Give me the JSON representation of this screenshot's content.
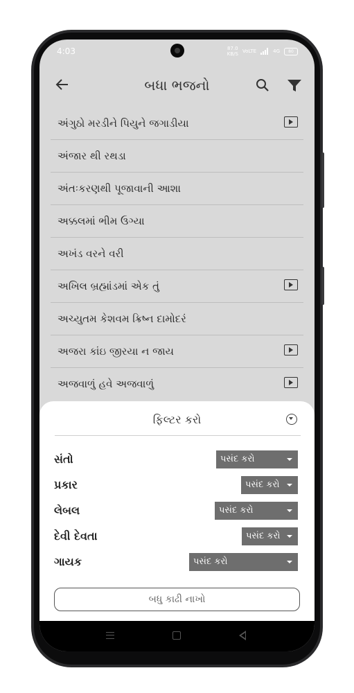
{
  "status_bar": {
    "time": "4:03",
    "net_speed_value": "87.0",
    "net_speed_unit": "KB/S",
    "volte": "VoLTE",
    "signal_2": "4G",
    "battery": "80"
  },
  "app_bar": {
    "title": "બધા ભજનો",
    "back_icon": "arrow-left",
    "search_icon": "magnifier",
    "filter_icon": "funnel"
  },
  "bhajans": [
    {
      "title": "અંગુઠો મરડીને પિયુને જગાડીયા",
      "has_video": true
    },
    {
      "title": "અંજાર થી રથડા",
      "has_video": false
    },
    {
      "title": "અંતઃકરણથી પૂજાવાની આશા",
      "has_video": false
    },
    {
      "title": "અક્કલમાં ભીમ ઉગ્યા",
      "has_video": false
    },
    {
      "title": "અખંડ વરને વરી",
      "has_video": false
    },
    {
      "title": "અખિલ બ્રહ્માંડમાં એક તું",
      "has_video": true
    },
    {
      "title": "અચ્યુતમ  કેશવમ  ક્રિષ્ન  દામોદરં",
      "has_video": false
    },
    {
      "title": "અજરા કાંઇ જીરયા ન જાય",
      "has_video": true
    },
    {
      "title": "અજવાળું હવે અજવાળું",
      "has_video": true
    }
  ],
  "filter_sheet": {
    "title": "ફિલ્ટર કરો",
    "filters": [
      {
        "label": "સંતો",
        "selected": "પસંદ કરો"
      },
      {
        "label": "પ્રકાર",
        "selected": "પસંદ કરો"
      },
      {
        "label": "લેબલ",
        "selected": "પસંદ કરો"
      },
      {
        "label": "દેવી દેવતા",
        "selected": "પસંદ કરો"
      },
      {
        "label": "ગાયક",
        "selected": "પસંદ કરો"
      }
    ],
    "clear_label": "બધુ કાઢી નાખો"
  },
  "colors": {
    "screen_bg": "#d9d9d9",
    "sheet_bg": "#ffffff",
    "select_bg": "#6e6e6e",
    "text": "#2b2b2b"
  }
}
